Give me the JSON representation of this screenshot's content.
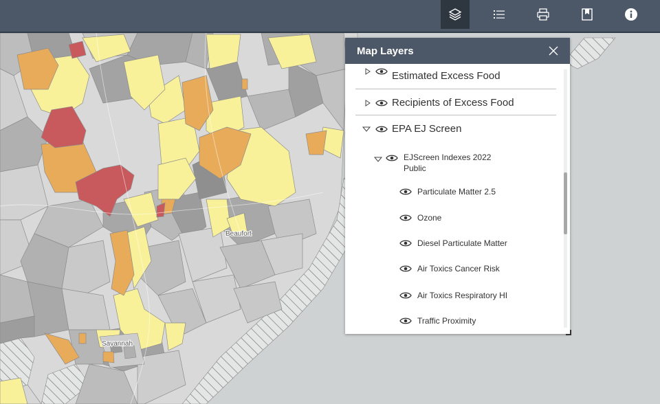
{
  "toolbar": {
    "buttons": [
      {
        "name": "layers-button",
        "icon": "layers-icon",
        "active": true
      },
      {
        "name": "legend-button",
        "icon": "list-icon",
        "active": false
      },
      {
        "name": "print-button",
        "icon": "printer-icon",
        "active": false
      },
      {
        "name": "bookmarks-button",
        "icon": "bookmark-icon",
        "active": false
      },
      {
        "name": "about-button",
        "icon": "info-icon",
        "active": false
      }
    ]
  },
  "map": {
    "city_labels": [
      "Beaufort",
      "Savannah"
    ],
    "colors": {
      "water": "#cfd2d3",
      "low": "#dadada",
      "mid": "#a9a9a9",
      "yellow": "#f9f199",
      "orange": "#e8ab5a",
      "red": "#c85a5e"
    }
  },
  "panel": {
    "title": "Map Layers",
    "layers": [
      {
        "label": "Estimated Excess Food",
        "expanded": false,
        "level": 0
      },
      {
        "label": "Recipients of Excess Food",
        "expanded": false,
        "level": 0
      },
      {
        "label": "EPA EJ Screen",
        "expanded": true,
        "level": 0
      },
      {
        "label_line1": "EJScreen Indexes 2022",
        "label_line2": "Public",
        "expanded": true,
        "level": 1
      },
      {
        "label": "Particulate Matter 2.5",
        "level": 2
      },
      {
        "label": "Ozone",
        "level": 2
      },
      {
        "label": "Diesel Particulate Matter",
        "level": 2
      },
      {
        "label": "Air Toxics Cancer Risk",
        "level": 2
      },
      {
        "label": "Air Toxics Respiratory HI",
        "level": 2
      },
      {
        "label": "Traffic Proximity",
        "level": 2
      }
    ]
  }
}
